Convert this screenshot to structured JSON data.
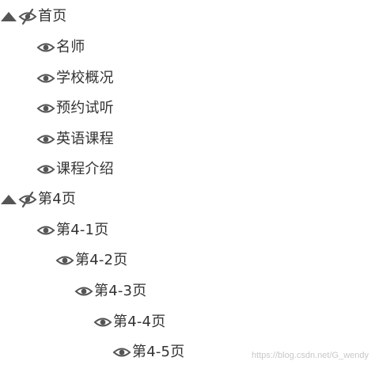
{
  "tree": {
    "items": [
      {
        "label": "首页",
        "expanded": true,
        "visible": false,
        "icon": "eye-off-icon"
      },
      {
        "label": "名师",
        "visible": true,
        "icon": "eye-icon"
      },
      {
        "label": "学校概况",
        "visible": true,
        "icon": "eye-icon"
      },
      {
        "label": "预约试听",
        "visible": true,
        "icon": "eye-icon"
      },
      {
        "label": "英语课程",
        "visible": true,
        "icon": "eye-icon"
      },
      {
        "label": "课程介绍",
        "visible": true,
        "icon": "eye-icon"
      },
      {
        "label": "第4页",
        "expanded": true,
        "visible": false,
        "icon": "eye-off-icon"
      },
      {
        "label": "第4-1页",
        "visible": true,
        "icon": "eye-icon"
      },
      {
        "label": "第4-2页",
        "visible": true,
        "icon": "eye-icon"
      },
      {
        "label": "第4-3页",
        "visible": true,
        "icon": "eye-icon"
      },
      {
        "label": "第4-4页",
        "visible": true,
        "icon": "eye-icon"
      },
      {
        "label": "第4-5页",
        "visible": true,
        "icon": "eye-icon"
      }
    ]
  },
  "watermark": {
    "text": "https://blog.csdn.net/G_wendy"
  },
  "colors": {
    "icon": "#555555",
    "text": "#333333",
    "watermark": "#c8c8c8"
  }
}
